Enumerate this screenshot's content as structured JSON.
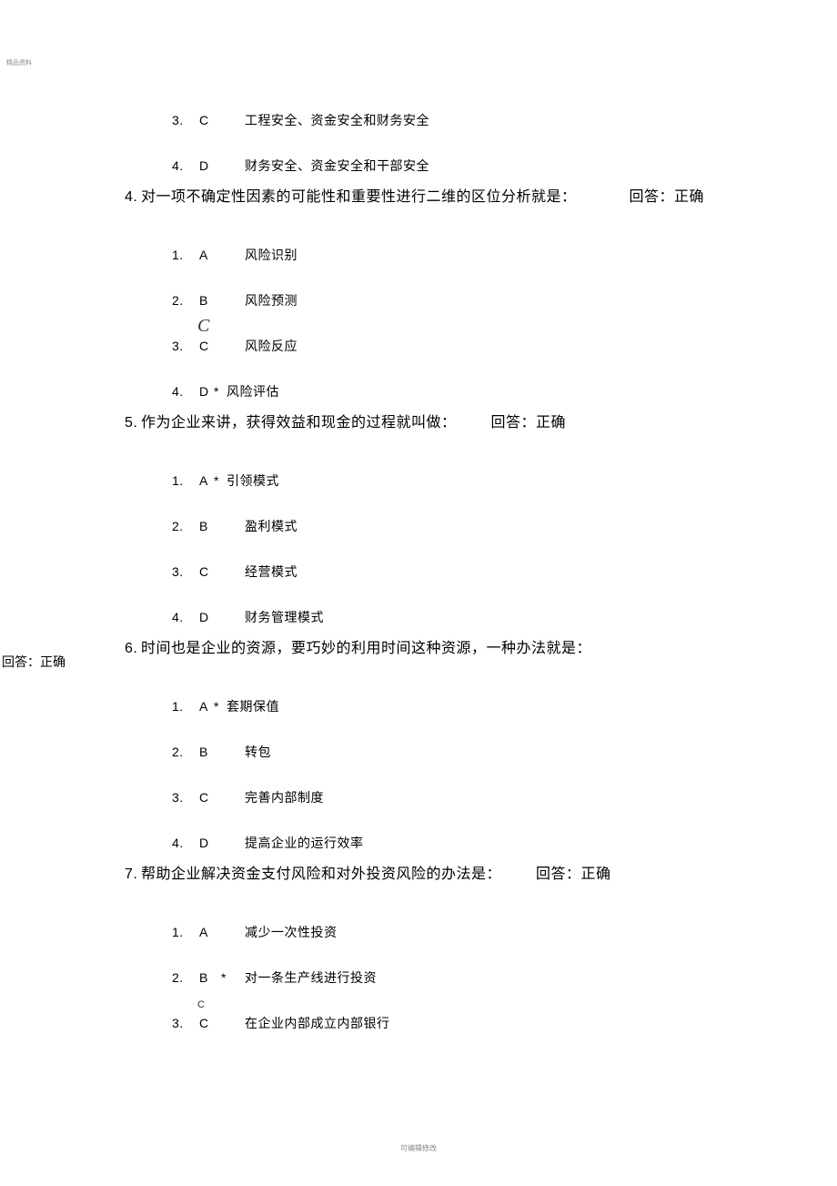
{
  "meta": {
    "corner": "精品资料",
    "footer": "可编辑修改"
  },
  "blocks": [
    {
      "type": "options_only",
      "options": [
        {
          "num": "3.",
          "letter": "C",
          "text": "工程安全、资金安全和财务安全"
        },
        {
          "num": "4.",
          "letter": "D",
          "text": "财务安全、资金安全和干部安全"
        }
      ]
    },
    {
      "type": "question",
      "num": "4.",
      "stem": "对一项不确定性因素的可能性和重要性进行二维的区位分析就是：",
      "feedback": "回答：正确",
      "feedback_style": "far",
      "annotation": "C",
      "annotation_on_index": 2,
      "options": [
        {
          "num": "1.",
          "letter": "A",
          "text": "风险识别"
        },
        {
          "num": "2.",
          "letter": "B",
          "text": "风险预测"
        },
        {
          "num": "3.",
          "letter": "C",
          "text": "风险反应"
        },
        {
          "num": "4.",
          "letter": "D",
          "star": "*",
          "tight": true,
          "text": "风险评估"
        }
      ]
    },
    {
      "type": "question",
      "num": "5.",
      "stem": "作为企业来讲，获得效益和现金的过程就叫做：",
      "feedback": "回答：正确",
      "feedback_style": "near",
      "options": [
        {
          "num": "1.",
          "letter": "A",
          "star": "*",
          "tight": true,
          "text": "引领模式"
        },
        {
          "num": "2.",
          "letter": "B",
          "text": "盈利模式"
        },
        {
          "num": "3.",
          "letter": "C",
          "text": "经营模式"
        },
        {
          "num": "4.",
          "letter": "D",
          "text": "财务管理模式"
        }
      ]
    },
    {
      "type": "question",
      "num": "6.",
      "stem": "时间也是企业的资源，要巧妙的利用时间这种资源，一种办法就是：",
      "feedback": "回答：正确",
      "feedback_style": "left",
      "options": [
        {
          "num": "1.",
          "letter": "A",
          "star": "*",
          "tight": true,
          "text": "套期保值"
        },
        {
          "num": "2.",
          "letter": "B",
          "text": "转包"
        },
        {
          "num": "3.",
          "letter": "C",
          "text": "完善内部制度"
        },
        {
          "num": "4.",
          "letter": "D",
          "text": "提高企业的运行效率"
        }
      ]
    },
    {
      "type": "question",
      "num": "7.",
      "stem": "帮助企业解决资金支付风险和对外投资风险的办法是：",
      "feedback": "回答：正确",
      "feedback_style": "near",
      "annotation_small": "C",
      "annotation_small_on_index": 2,
      "options": [
        {
          "num": "1.",
          "letter": "A",
          "text": "减少一次性投资"
        },
        {
          "num": "2.",
          "letter": "B",
          "star": "*",
          "text": "对一条生产线进行投资"
        },
        {
          "num": "3.",
          "letter": "C",
          "text": "在企业内部成立内部银行"
        }
      ]
    }
  ]
}
